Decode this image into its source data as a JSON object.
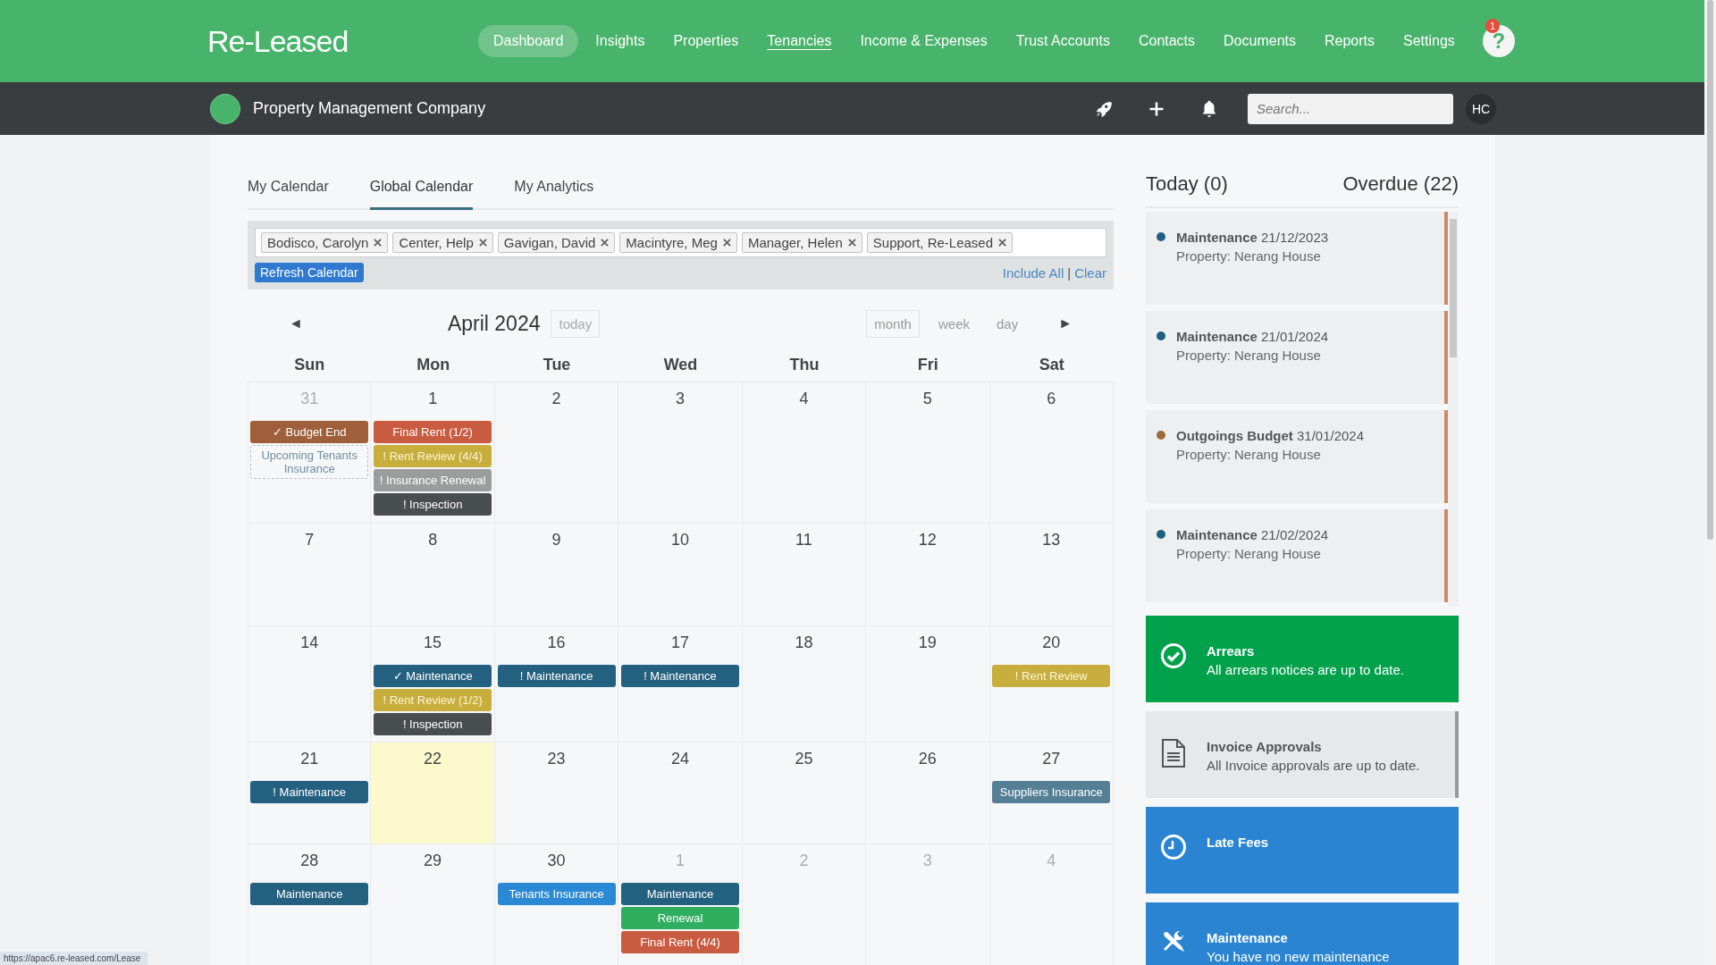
{
  "brand": "Re-Leased",
  "nav": [
    {
      "label": "Dashboard",
      "selected": true,
      "hovered": false
    },
    {
      "label": "Insights",
      "selected": false,
      "hovered": false
    },
    {
      "label": "Properties",
      "selected": false,
      "hovered": false
    },
    {
      "label": "Tenancies",
      "selected": false,
      "hovered": true
    },
    {
      "label": "Income & Expenses",
      "selected": false,
      "hovered": false
    },
    {
      "label": "Trust Accounts",
      "selected": false,
      "hovered": false
    },
    {
      "label": "Contacts",
      "selected": false,
      "hovered": false
    },
    {
      "label": "Documents",
      "selected": false,
      "hovered": false
    },
    {
      "label": "Reports",
      "selected": false,
      "hovered": false
    },
    {
      "label": "Settings",
      "selected": false,
      "hovered": false
    }
  ],
  "help": {
    "label": "?",
    "badge": "1"
  },
  "company": "Property Management Company",
  "search": {
    "placeholder": "Search..."
  },
  "avatar": "HC",
  "tabs": [
    {
      "label": "My Calendar",
      "selected": false
    },
    {
      "label": "Global Calendar",
      "selected": true
    },
    {
      "label": "My Analytics",
      "selected": false
    }
  ],
  "filters": [
    "Bodisco, Carolyn",
    "Center, Help",
    "Gavigan, David",
    "Macintyre, Meg",
    "Manager, Helen",
    "Support, Re-Leased"
  ],
  "refresh_button": "Refresh Calendar",
  "include_all": "Include All",
  "separator": "|",
  "clear": "Clear",
  "calendar": {
    "prev": "◄",
    "next": "►",
    "title": "April 2024",
    "today_button": "today",
    "views": [
      {
        "label": "month",
        "selected": true
      },
      {
        "label": "week",
        "selected": false
      },
      {
        "label": "day",
        "selected": false
      }
    ],
    "weekdays": [
      "Sun",
      "Mon",
      "Tue",
      "Wed",
      "Thu",
      "Fri",
      "Sat"
    ],
    "weeks": [
      [
        {
          "day": "31",
          "muted": true,
          "today": false,
          "events": [
            {
              "label": "✓ Budget End",
              "kind": "budget"
            },
            {
              "label": "Upcoming Tenants Insurance",
              "kind": "upcoming"
            }
          ]
        },
        {
          "day": "1",
          "muted": false,
          "today": false,
          "events": [
            {
              "label": "Final Rent (1/2)",
              "kind": "final-rent"
            },
            {
              "label": "! Rent Review (4/4)",
              "kind": "rent-review"
            },
            {
              "label": "! Insurance Renewal",
              "kind": "insurance"
            },
            {
              "label": "! Inspection",
              "kind": "inspection"
            }
          ]
        },
        {
          "day": "2",
          "muted": false,
          "today": false
        },
        {
          "day": "3",
          "muted": false,
          "today": false
        },
        {
          "day": "4",
          "muted": false,
          "today": false
        },
        {
          "day": "5",
          "muted": false,
          "today": false
        },
        {
          "day": "6",
          "muted": false,
          "today": false
        }
      ],
      [
        {
          "day": "7",
          "muted": false,
          "today": false
        },
        {
          "day": "8",
          "muted": false,
          "today": false
        },
        {
          "day": "9",
          "muted": false,
          "today": false
        },
        {
          "day": "10",
          "muted": false,
          "today": false
        },
        {
          "day": "11",
          "muted": false,
          "today": false
        },
        {
          "day": "12",
          "muted": false,
          "today": false
        },
        {
          "day": "13",
          "muted": false,
          "today": false
        }
      ],
      [
        {
          "day": "14",
          "muted": false,
          "today": false
        },
        {
          "day": "15",
          "muted": false,
          "today": false,
          "events": [
            {
              "label": "✓ Maintenance",
              "kind": "maintenance"
            },
            {
              "label": "! Rent Review (1/2)",
              "kind": "rent-review"
            },
            {
              "label": "! Inspection",
              "kind": "inspection"
            }
          ]
        },
        {
          "day": "16",
          "muted": false,
          "today": false,
          "events": [
            {
              "label": "! Maintenance",
              "kind": "maintenance"
            }
          ]
        },
        {
          "day": "17",
          "muted": false,
          "today": false,
          "events": [
            {
              "label": "! Maintenance",
              "kind": "maintenance"
            }
          ]
        },
        {
          "day": "18",
          "muted": false,
          "today": false
        },
        {
          "day": "19",
          "muted": false,
          "today": false
        },
        {
          "day": "20",
          "muted": false,
          "today": false,
          "events": [
            {
              "label": "! Rent Review",
              "kind": "rent-review"
            }
          ]
        }
      ],
      [
        {
          "day": "21",
          "muted": false,
          "today": false,
          "events": [
            {
              "label": "! Maintenance",
              "kind": "maintenance"
            }
          ]
        },
        {
          "day": "22",
          "muted": false,
          "today": true
        },
        {
          "day": "23",
          "muted": false,
          "today": false
        },
        {
          "day": "24",
          "muted": false,
          "today": false
        },
        {
          "day": "25",
          "muted": false,
          "today": false
        },
        {
          "day": "26",
          "muted": false,
          "today": false
        },
        {
          "day": "27",
          "muted": false,
          "today": false,
          "events": [
            {
              "label": "Suppliers Insurance",
              "kind": "suppliers"
            }
          ]
        }
      ],
      [
        {
          "day": "28",
          "muted": false,
          "today": false,
          "events": [
            {
              "label": "Maintenance",
              "kind": "maintenance"
            }
          ]
        },
        {
          "day": "29",
          "muted": false,
          "today": false
        },
        {
          "day": "30",
          "muted": false,
          "today": false,
          "events": [
            {
              "label": "Tenants Insurance",
              "kind": "tenants-insurance"
            }
          ]
        },
        {
          "day": "1",
          "muted": true,
          "today": false,
          "events": [
            {
              "label": "Maintenance",
              "kind": "maintenance"
            },
            {
              "label": "Renewal",
              "kind": "renewal"
            },
            {
              "label": "Final Rent (4/4)",
              "kind": "final-rent"
            }
          ]
        },
        {
          "day": "2",
          "muted": true,
          "today": false
        },
        {
          "day": "3",
          "muted": true,
          "today": false
        },
        {
          "day": "4",
          "muted": true,
          "today": false
        }
      ]
    ]
  },
  "today_heading": "Today (0)",
  "overdue_heading": "Overdue (22)",
  "overdue": [
    {
      "title": "Maintenance",
      "date": "21/12/2023",
      "property": "Property: Nerang House",
      "color": "#1f5f80"
    },
    {
      "title": "Maintenance",
      "date": "21/01/2024",
      "property": "Property: Nerang House",
      "color": "#1f5f80"
    },
    {
      "title": "Outgoings Budget",
      "date": "31/01/2024",
      "property": "Property: Nerang House",
      "color": "#9c6b3e"
    },
    {
      "title": "Maintenance",
      "date": "21/02/2024",
      "property": "Property: Nerang House",
      "color": "#1f5f80"
    }
  ],
  "status_cards": [
    {
      "kind": "arrears",
      "title": "Arrears",
      "text": "All arrears notices are up to date."
    },
    {
      "kind": "invoice",
      "title": "Invoice Approvals",
      "text": "All Invoice approvals are up to date."
    },
    {
      "kind": "late-fees",
      "title": "Late Fees"
    },
    {
      "kind": "maintenance",
      "title": "Maintenance",
      "text": "You have no new maintenance"
    }
  ],
  "status_url": "https://apac6.re-leased.com/Lease"
}
